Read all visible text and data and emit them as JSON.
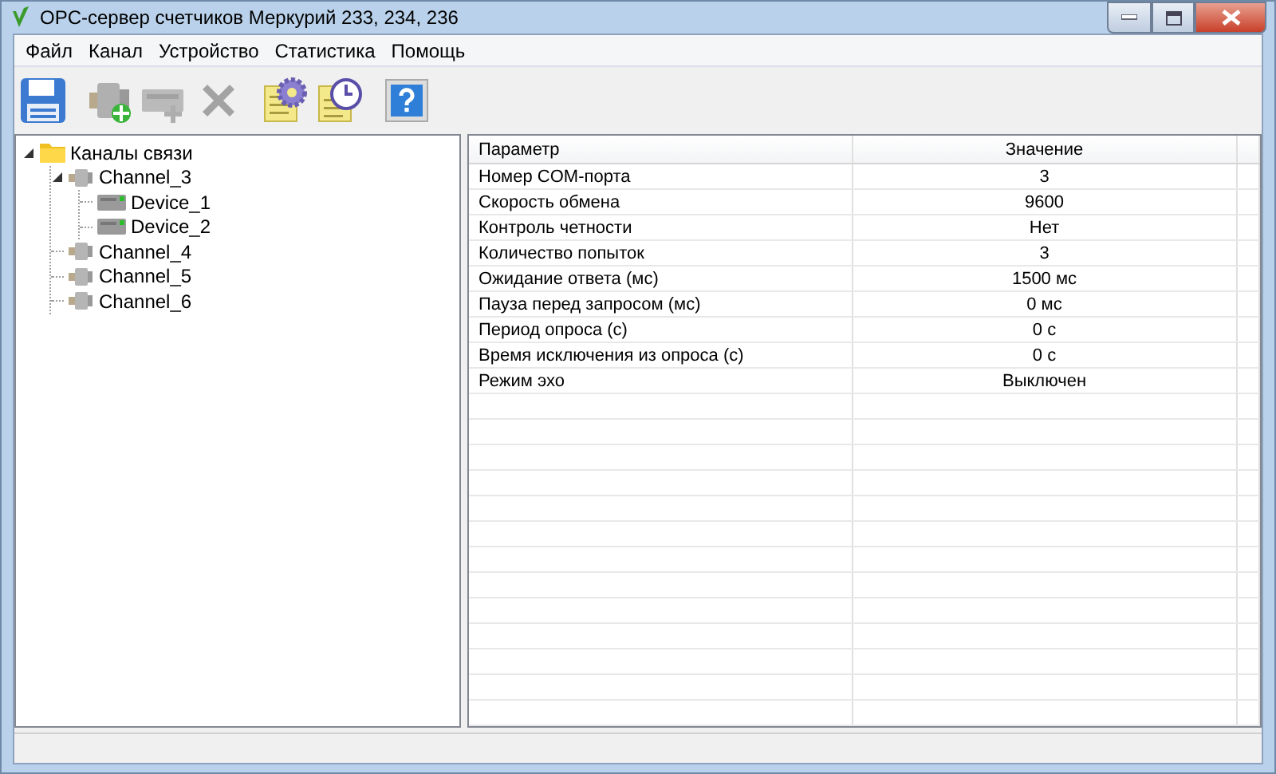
{
  "window": {
    "title": "OPC-сервер счетчиков Меркурий 233, 234, 236"
  },
  "menu": [
    "Файл",
    "Канал",
    "Устройство",
    "Статистика",
    "Помощь"
  ],
  "toolbar": [
    {
      "kind": "save",
      "disabled": false
    },
    {
      "kind": "add-channel",
      "disabled": false
    },
    {
      "kind": "add-device",
      "disabled": true
    },
    {
      "kind": "delete",
      "disabled": true
    },
    {
      "kind": "settings",
      "disabled": false
    },
    {
      "kind": "schedule",
      "disabled": false
    },
    {
      "kind": "help",
      "disabled": false
    }
  ],
  "tree": [
    {
      "label": "Каналы связи",
      "kind": "folder",
      "expanded": true,
      "children": [
        {
          "label": "Channel_3",
          "kind": "channel",
          "expanded": true,
          "children": [
            {
              "label": "Device_1",
              "kind": "device"
            },
            {
              "label": "Device_2",
              "kind": "device"
            }
          ]
        },
        {
          "label": "Channel_4",
          "kind": "channel"
        },
        {
          "label": "Channel_5",
          "kind": "channel"
        },
        {
          "label": "Channel_6",
          "kind": "channel"
        }
      ]
    }
  ],
  "table": {
    "columns": [
      "Параметр",
      "Значение"
    ],
    "rows": [
      [
        "Номер COM-порта",
        "3"
      ],
      [
        "Скорость обмена",
        "9600"
      ],
      [
        "Контроль четности",
        "Нет"
      ],
      [
        "Количество попыток",
        "3"
      ],
      [
        "Ожидание ответа (мс)",
        "1500 мс"
      ],
      [
        "Пауза перед запросом (мс)",
        "0 мс"
      ],
      [
        "Период опроса (с)",
        "0 с"
      ],
      [
        "Время исключения из опроса (с)",
        "0 с"
      ],
      [
        "Режим эхо",
        "Выключен"
      ]
    ]
  }
}
